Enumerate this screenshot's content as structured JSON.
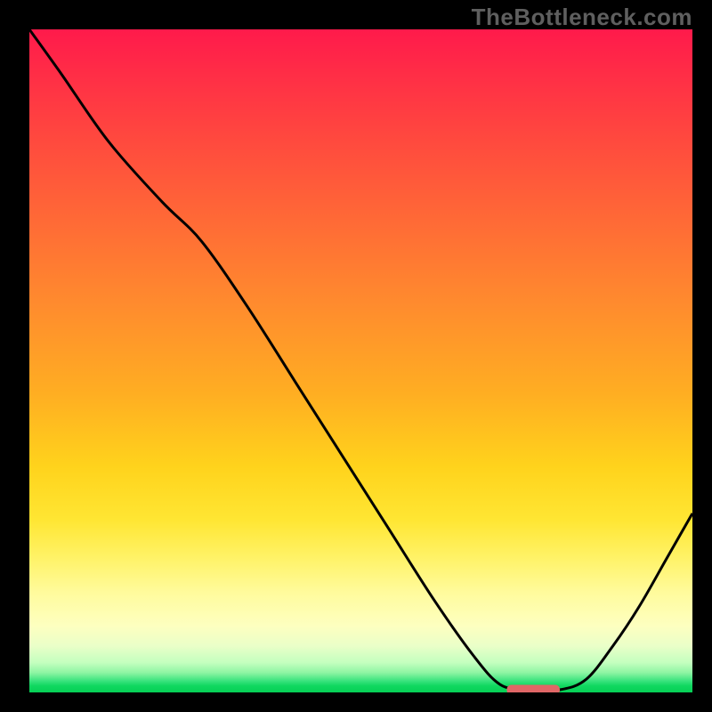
{
  "watermark": "TheBottleneck.com",
  "colors": {
    "curve_stroke": "#000000",
    "marker_fill": "#e06666",
    "frame_bg": "#000000"
  },
  "chart_data": {
    "type": "line",
    "title": "",
    "xlabel": "",
    "ylabel": "",
    "xlim": [
      0,
      100
    ],
    "ylim": [
      0,
      100
    ],
    "grid": false,
    "legend": false,
    "series": [
      {
        "name": "bottleneck-curve",
        "x": [
          0,
          5,
          12,
          20,
          26,
          33,
          40,
          47,
          54,
          61,
          67,
          71,
          75,
          80,
          84,
          88,
          92,
          96,
          100
        ],
        "y": [
          100,
          93,
          83,
          74,
          68,
          58,
          47,
          36,
          25,
          14,
          5.5,
          1.2,
          0.4,
          0.4,
          2,
          7,
          13,
          20,
          27
        ]
      }
    ],
    "marker": {
      "name": "optimal-range-marker",
      "x_start": 72,
      "x_end": 80,
      "y": 0.4,
      "shape": "rounded-bar"
    },
    "background_gradient": {
      "top": "#ff1a4b",
      "mid1": "#ff8a2e",
      "mid2": "#ffe633",
      "bottom": "#06cf55"
    }
  }
}
